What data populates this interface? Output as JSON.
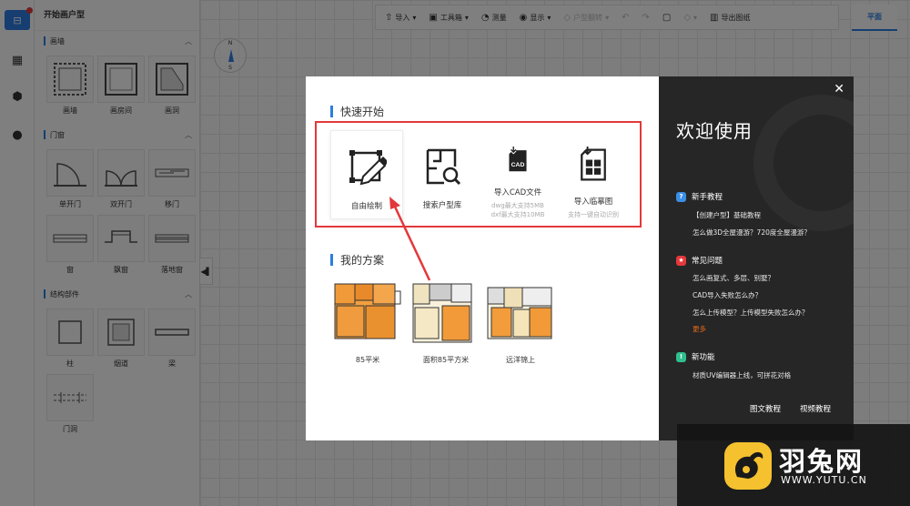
{
  "app": {
    "panel_title": "开始画户型",
    "view_tab": "平面"
  },
  "toolbar": {
    "items": [
      {
        "label": "导入",
        "icon": "upload-icon"
      },
      {
        "label": "工具箱",
        "icon": "toolbox-icon"
      },
      {
        "label": "测量",
        "icon": "measure-icon"
      },
      {
        "label": "显示",
        "icon": "eye-icon"
      },
      {
        "label": "户型翻转",
        "icon": "flip-icon"
      },
      {
        "label": "导出图纸",
        "icon": "map-icon"
      }
    ]
  },
  "compass": {
    "north": "N",
    "south": "S"
  },
  "panel": {
    "sections": [
      {
        "title": "画墙",
        "items": [
          "画墙",
          "画房间",
          "画洞"
        ]
      },
      {
        "title": "门窗",
        "items": [
          "单开门",
          "双开门",
          "移门",
          "窗",
          "飘窗",
          "落地窗"
        ]
      },
      {
        "title": "结构部件",
        "items": [
          "柱",
          "烟道",
          "梁",
          "门洞"
        ]
      }
    ]
  },
  "modal": {
    "quick_start_title": "快速开始",
    "quick_start": [
      {
        "label": "自由绘制",
        "sub": "",
        "icon": "pencil-draw-icon"
      },
      {
        "label": "搜索户型库",
        "sub": "",
        "icon": "floorplan-search-icon"
      },
      {
        "label": "导入CAD文件",
        "sub": "dwg最大支持5MB\ndxf最大支持10MB",
        "icon": "cad-file-icon"
      },
      {
        "label": "导入临摹图",
        "sub": "支持一键自动识别",
        "icon": "trace-image-icon"
      }
    ],
    "my_plans_title": "我的方案",
    "plans": [
      {
        "label": "85平米"
      },
      {
        "label": "面积85平方米"
      },
      {
        "label": "远洋锦上"
      }
    ],
    "welcome": "欢迎使用",
    "sections": [
      {
        "title": "新手教程",
        "badge_color": "#3a8ee6",
        "badge": "?",
        "links": [
          "【创建户型】基础教程",
          "怎么做3D全屋漫游？720度全屋漫游？"
        ]
      },
      {
        "title": "常见问题",
        "badge_color": "#e5383b",
        "badge": "★",
        "links": [
          "怎么画复式、多层、别墅？",
          "CAD导入失败怎么办？",
          "怎么上传模型？上传模型失败怎么办？"
        ],
        "more": "更多"
      },
      {
        "title": "新功能",
        "badge_color": "#2fbf8f",
        "badge": "!",
        "links": [
          "材质UV编辑器上线，可拼花对格"
        ]
      }
    ],
    "footer": [
      "图文教程",
      "视频教程"
    ]
  },
  "watermark": {
    "name": "羽兔网",
    "url": "WWW.YUTU.CN"
  },
  "colors": {
    "accent": "#2d7de0",
    "highlight": "#e3383b",
    "dark_panel": "#262626",
    "more_link": "#e66a1a"
  }
}
